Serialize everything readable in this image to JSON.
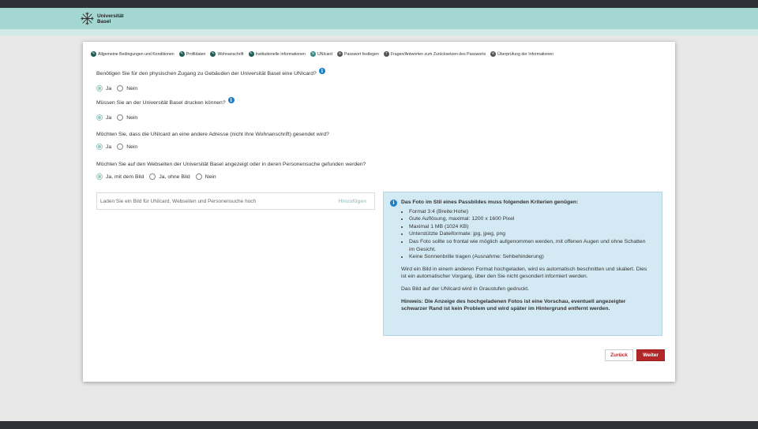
{
  "logo": {
    "line1": "Universität",
    "line2": "Basel"
  },
  "steps": [
    {
      "label": "Allgemeine Bedingungen und Konditionen",
      "state": "done",
      "icon": "pencil-icon"
    },
    {
      "label": "Profildaten",
      "state": "done",
      "icon": "pencil-icon"
    },
    {
      "label": "Wohnanschrift",
      "state": "done",
      "icon": "pencil-icon"
    },
    {
      "label": "Institutionelle Informationen",
      "state": "done",
      "icon": "pencil-icon"
    },
    {
      "label": "UNIcard",
      "state": "current",
      "icon": "number-icon",
      "number": "5"
    },
    {
      "label": "Passwort festlegen",
      "state": "todo",
      "icon": "number-icon",
      "number": "6"
    },
    {
      "label": "Fragen/Antworten zum Zurücksetzen des Passworts",
      "state": "todo",
      "icon": "number-icon",
      "number": "7"
    },
    {
      "label": "Überprüfung der Informationen",
      "state": "todo",
      "icon": "number-icon",
      "number": "8"
    }
  ],
  "questions": [
    {
      "text": "Benötigen Sie für den physischen Zugang zu Gebäuden der Universität Basel eine UNIcard?",
      "info": true,
      "options": [
        "Ja",
        "Nein"
      ],
      "selected": 0
    },
    {
      "text": "Müssen Sie an der Universität Basel drucken können?",
      "info": true,
      "options": [
        "Ja",
        "Nein"
      ],
      "selected": 0
    },
    {
      "text": "Möchten Sie, dass die UNIcard an eine andere Adresse (nicht Ihre Wohnanschrift) gesendet wird?",
      "info": false,
      "options": [
        "Ja",
        "Nein"
      ],
      "selected": 0
    },
    {
      "text": "Möchten Sie auf den Webseiten der Universität Basel angezeigt oder in deren Personensuche gefunden werden?",
      "info": false,
      "options": [
        "Ja, mit dem Bild",
        "Ja, ohne Bild",
        "Nein"
      ],
      "selected": 0
    }
  ],
  "upload": {
    "placeholder": "Laden Sie ein Bild für UNIcard, Webseiten und Personensuche hoch",
    "button": "Hinzufügen"
  },
  "infobox": {
    "title": "Das Foto im Stil eines Passbildes muss folgenden Kriterien genügen:",
    "items": [
      "Format 3:4 (Breite:Hohe)",
      "Gute Auflösung, maximal: 1200 x 1600 Pixel",
      "Maximal 1 MB (1024 KB)",
      "Unterstützte Dateiformate: jpg, jpeg, png",
      "Das Foto sollte so frontal wie möglich aufgenommen werden, mit offenen Augen und ohne Schatten im Gesicht.",
      "Keine Sonnenbrille tragen (Ausnahme: Sehbehinderung)"
    ],
    "para1": "Wird ein Bild in einem anderen Format hochgeladen, wird es automatisch beschnitten und skaliert. Dies ist ein automatischer Vorgang, über den Sie nicht gesondert informiert werden.",
    "para2": "Das Bild auf der UNIcard wird in Graustufen gedruckt.",
    "note": "Hinweis: Die Anzeige des hochgeladenen Fotos ist eine Vorschau, eventuell angezeigter schwarzer Rand ist kein Problem und wird später im Hintergrund entfernt werden."
  },
  "buttons": {
    "back": "Zurück",
    "next": "Weiter"
  },
  "colors": {
    "header": "#a5d7d2",
    "accent": "#b22727",
    "info": "#1c7fc4",
    "infobox_bg": "#d3e9f3"
  }
}
